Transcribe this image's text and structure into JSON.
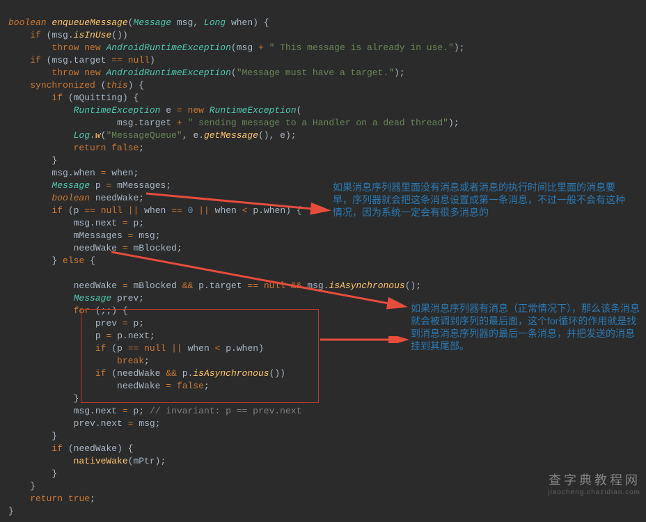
{
  "code": {
    "l1a": "boolean",
    "l1b": "enqueueMessage",
    "l1c": "Message",
    "l1d": "msg",
    "l1e": "Long",
    "l1f": "when",
    "l2a": "if",
    "l2b": "msg",
    "l2c": "isInUse",
    "l3a": "throw",
    "l3b": "new",
    "l3c": "AndroidRuntimeException",
    "l3d": "msg",
    "l3e": "\" This message is already in use.\"",
    "l4a": "if",
    "l4b": "msg",
    "l4c": "target",
    "l4d": "null",
    "l5a": "throw",
    "l5b": "new",
    "l5c": "AndroidRuntimeException",
    "l5d": "\"Message must have a target.\"",
    "l6a": "synchronized",
    "l6b": "this",
    "l7a": "if",
    "l7b": "mQuitting",
    "l8a": "RuntimeException",
    "l8b": "e",
    "l8c": "new",
    "l8d": "RuntimeException",
    "l9a": "msg",
    "l9b": "target",
    "l9c": "\" sending message to a Handler on a dead thread\"",
    "l10a": "Log",
    "l10b": "w",
    "l10c": "\"MessageQueue\"",
    "l10d": "e",
    "l10e": "getMessage",
    "l10f": "e",
    "l11a": "return",
    "l11b": "false",
    "l12a": "msg",
    "l12b": "when",
    "l12c": "when",
    "l13a": "Message",
    "l13b": "p",
    "l13c": "mMessages",
    "l14a": "boolean",
    "l14b": "needWake",
    "l15a": "if",
    "l15b": "p",
    "l15c": "null",
    "l15d": "when",
    "l15e": "0",
    "l15f": "when",
    "l15g": "p",
    "l15h": "when",
    "l16a": "msg",
    "l16b": "next",
    "l16c": "p",
    "l17a": "mMessages",
    "l17b": "msg",
    "l18a": "needWake",
    "l18b": "mBlocked",
    "l19a": "else",
    "l20a": "needWake",
    "l20b": "mBlocked",
    "l20c": "p",
    "l20d": "target",
    "l20e": "null",
    "l20f": "msg",
    "l20g": "isAsynchronous",
    "l21a": "Message",
    "l21b": "prev",
    "l22a": "for",
    "l23a": "prev",
    "l23b": "p",
    "l24a": "p",
    "l24b": "p",
    "l24c": "next",
    "l25a": "if",
    "l25b": "p",
    "l25c": "null",
    "l25d": "when",
    "l25e": "p",
    "l25f": "when",
    "l26a": "break",
    "l27a": "if",
    "l27b": "needWake",
    "l27c": "p",
    "l27d": "isAsynchronous",
    "l28a": "needWake",
    "l28b": "false",
    "l29a": "msg",
    "l29b": "next",
    "l29c": "p",
    "l29d": "// invariant: p == prev.next",
    "l30a": "prev",
    "l30b": "next",
    "l30c": "msg",
    "l31a": "if",
    "l31b": "needWake",
    "l32a": "nativeWake",
    "l32b": "mPtr",
    "l33a": "return",
    "l33b": "true"
  },
  "annotations": {
    "a1": "如果消息序列器里面没有消息或者消息的执行时间比里面的消息要早，序列器就会把这条消息设置成第一条消息，不过一般不会有这种情况，因为系统一定会有很多消息的",
    "a2": "如果消息序列器有消息（正常情况下），那么该条消息就会被调到序列的最后面，这个for循环的作用就是找到消息消息序列器的最后一条消息，并把发送的消息挂到其尾部。"
  },
  "watermark": {
    "title": "查字典教程网",
    "url": "jiaocheng.chazidian.com"
  }
}
